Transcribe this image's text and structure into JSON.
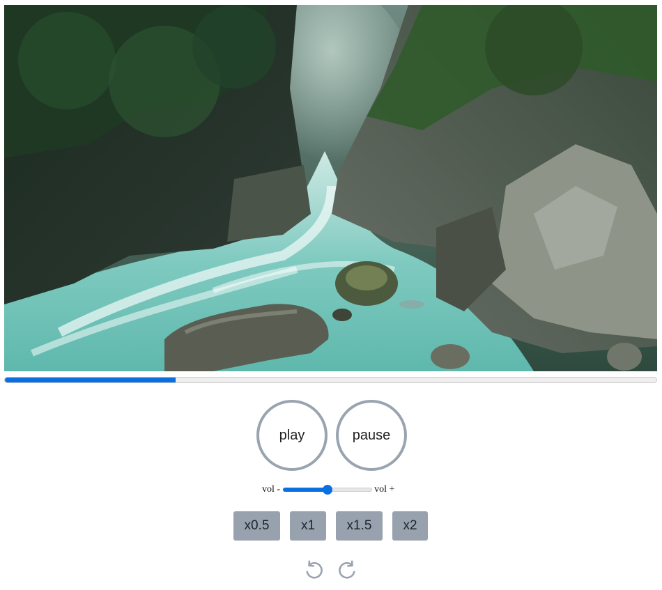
{
  "video": {
    "description_icon": "video-frame",
    "progress_fraction": 0.262
  },
  "controls": {
    "play_label": "play",
    "pause_label": "pause"
  },
  "volume": {
    "minus_label": "vol -",
    "plus_label": "vol +",
    "level_fraction": 0.5
  },
  "speed": {
    "options": [
      "x0.5",
      "x1",
      "x1.5",
      "x2"
    ]
  },
  "skip": {
    "back_icon": "rotate-ccw-icon",
    "forward_icon": "rotate-cw-icon"
  },
  "colors": {
    "accent": "#0a6fe0",
    "button_gray": "#98a2ae",
    "ring_gray": "#9aa4b1"
  }
}
